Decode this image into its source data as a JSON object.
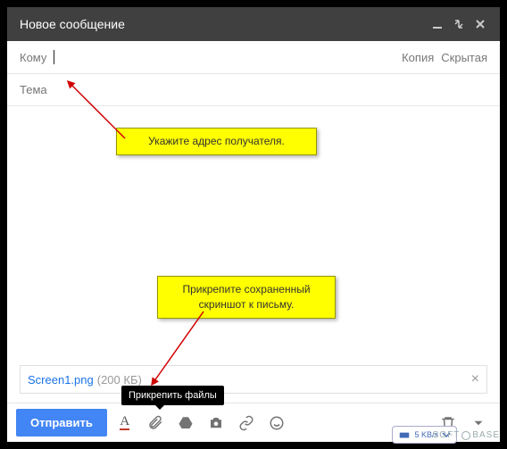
{
  "titlebar": {
    "title": "Новое сообщение"
  },
  "recipients": {
    "to_label": "Кому",
    "cc_label": "Копия",
    "bcc_label": "Скрытая"
  },
  "subject": {
    "placeholder": "Тема"
  },
  "callouts": {
    "recipient_hint": "Укажите адрес получателя.",
    "attach_hint": "Прикрепите сохраненный скриншот к письму."
  },
  "attachment": {
    "name": "Screen1.png",
    "size": "(200 КБ)"
  },
  "tooltip": {
    "attach": "Прикрепить файлы"
  },
  "toolbar": {
    "send": "Отправить"
  },
  "network": {
    "speed": "5 KB/s"
  },
  "watermark": {
    "left": "SOFT",
    "right": "BASE"
  }
}
